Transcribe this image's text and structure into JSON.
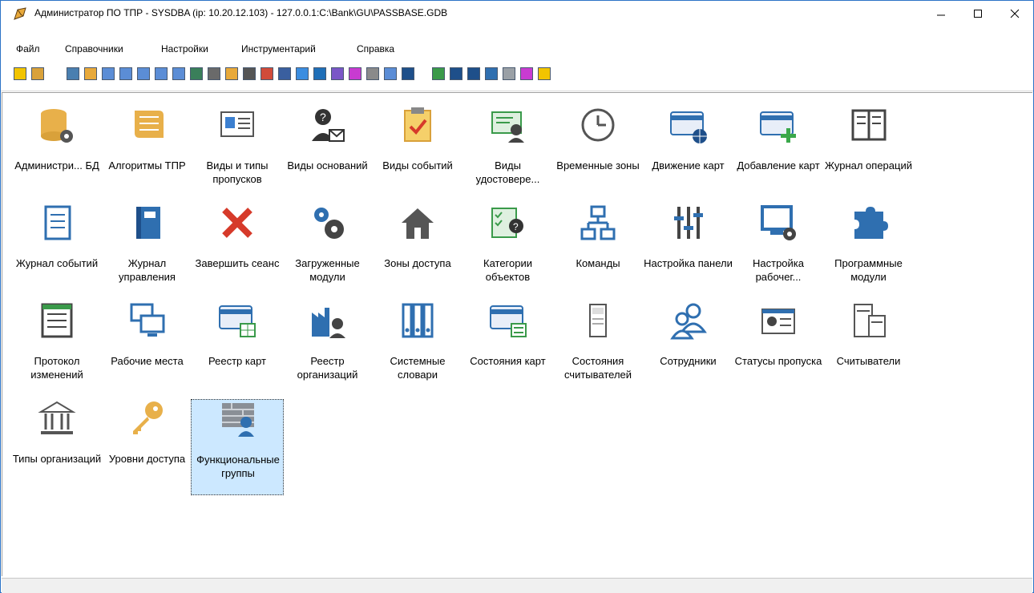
{
  "window": {
    "title": "Администратор ПО ТПР - SYSDBA  (ip: 10.20.12.103) - 127.0.0.1:C:\\Bank\\GU\\PASSBASE.GDB"
  },
  "menu": [
    {
      "label": "Файл"
    },
    {
      "label": "Справочники"
    },
    {
      "label": "Настройки"
    },
    {
      "label": "Инструментарий"
    },
    {
      "label": "Справка"
    }
  ],
  "toolbar_icons": [
    "exit-icon",
    "open-icon",
    "admin-db-icon",
    "pass-types-icon",
    "algorithms-icon",
    "modules-icon",
    "grid1-icon",
    "grid2-icon",
    "grid3-icon",
    "grid4-icon",
    "grid5-icon",
    "computer-icon",
    "user-key-icon",
    "checklist-icon",
    "home-icon",
    "save-icon",
    "workstation-icon",
    "puzzle-icon",
    "columns-icon",
    "chart-icon",
    "bank-icon",
    "card-icon",
    "list-icon",
    "panel-icon",
    "log-icon",
    "book-icon",
    "card-reg-icon",
    "settings-icon",
    "download-icon"
  ],
  "items": [
    {
      "label": "Администри... БД",
      "icon": "database-gear-icon"
    },
    {
      "label": "Алгоритмы ТПР",
      "icon": "scroll-icon"
    },
    {
      "label": "Виды и типы пропусков",
      "icon": "id-card-icon"
    },
    {
      "label": "Виды оснований",
      "icon": "person-question-mail-icon"
    },
    {
      "label": "Виды событий",
      "icon": "clipboard-check-icon"
    },
    {
      "label": "Виды удостовере...",
      "icon": "certificate-person-icon"
    },
    {
      "label": "Временные зоны",
      "icon": "clock-icon"
    },
    {
      "label": "Движение карт",
      "icon": "card-globe-icon"
    },
    {
      "label": "Добавление карт",
      "icon": "card-plus-icon"
    },
    {
      "label": "Журнал операций",
      "icon": "open-book-icon"
    },
    {
      "label": "Журнал событий",
      "icon": "notebook-icon"
    },
    {
      "label": "Журнал управления",
      "icon": "blue-book-icon"
    },
    {
      "label": "Завершить сеанс",
      "icon": "red-x-icon"
    },
    {
      "label": "Загруженные модули",
      "icon": "gears-icon"
    },
    {
      "label": "Зоны доступа",
      "icon": "house-icon"
    },
    {
      "label": "Категории объектов",
      "icon": "checklist-person-icon"
    },
    {
      "label": "Команды",
      "icon": "hierarchy-icon"
    },
    {
      "label": "Настройка панели",
      "icon": "sliders-icon"
    },
    {
      "label": "Настройка рабочег...",
      "icon": "monitor-gear-icon"
    },
    {
      "label": "Программные модули",
      "icon": "puzzle-icon"
    },
    {
      "label": "Протокол изменений",
      "icon": "ledger-icon"
    },
    {
      "label": "Рабочие места",
      "icon": "workstations-icon"
    },
    {
      "label": "Реестр карт",
      "icon": "card-table-icon"
    },
    {
      "label": "Реестр организаций",
      "icon": "factory-person-icon"
    },
    {
      "label": "Системные словари",
      "icon": "binders-icon"
    },
    {
      "label": "Состояния карт",
      "icon": "card-state-icon"
    },
    {
      "label": "Состояния считывателей",
      "icon": "reader-icon"
    },
    {
      "label": "Сотрудники",
      "icon": "people-icon"
    },
    {
      "label": "Статусы пропуска",
      "icon": "badge-status-icon"
    },
    {
      "label": "Считыватели",
      "icon": "readers-icon"
    },
    {
      "label": "Типы организаций",
      "icon": "bank-building-icon"
    },
    {
      "label": "Уровни доступа",
      "icon": "key-icon"
    },
    {
      "label": "Функциональные группы",
      "icon": "wall-person-icon"
    }
  ]
}
